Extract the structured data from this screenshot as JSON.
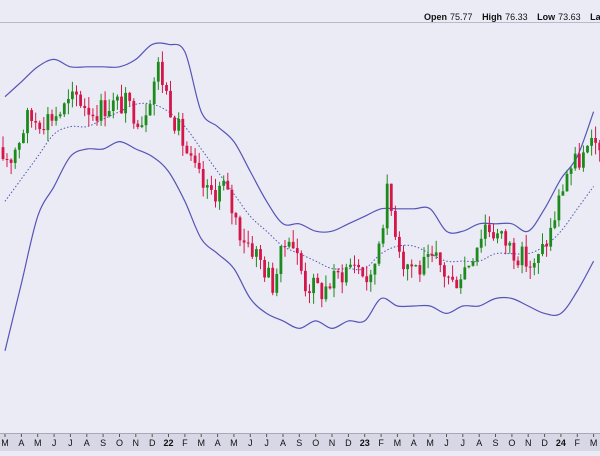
{
  "header": {
    "open_label": "Open",
    "open_value": "75.77",
    "high_label": "High",
    "high_value": "76.33",
    "low_label": "Low",
    "low_value": "73.63",
    "last_label": "Last"
  },
  "colors": {
    "background": "#ebebf5",
    "up_candle": "#1c8a1c",
    "down_candle": "#d5164a",
    "bollinger": "#5555b8",
    "axis_bg": "#d7d7e6"
  },
  "chart_data": {
    "type": "candlestick",
    "indicators": [
      "bollinger-bands-upper",
      "bollinger-bands-middle-dotted",
      "bollinger-bands-lower"
    ],
    "grid": false,
    "ylim": [
      37,
      92
    ],
    "x_tick_labels": [
      "M",
      "A",
      "M",
      "J",
      "J",
      "A",
      "S",
      "O",
      "N",
      "D",
      "22",
      "F",
      "M",
      "A",
      "M",
      "J",
      "J",
      "A",
      "S",
      "O",
      "N",
      "D",
      "23",
      "F",
      "M",
      "A",
      "M",
      "J",
      "J",
      "A",
      "S",
      "O",
      "N",
      "D",
      "24",
      "F",
      "M"
    ],
    "bold_tick_labels": [
      "22",
      "23",
      "24"
    ],
    "x": [
      "2021-03",
      "2021-04",
      "2021-05",
      "2021-06",
      "2021-07",
      "2021-08",
      "2021-09",
      "2021-10",
      "2021-11",
      "2021-12",
      "2022-01",
      "2022-02",
      "2022-03",
      "2022-04",
      "2022-05",
      "2022-06",
      "2022-07",
      "2022-08",
      "2022-09",
      "2022-10",
      "2022-11",
      "2022-12",
      "2023-01",
      "2023-02",
      "2023-03",
      "2023-04",
      "2023-05",
      "2023-06",
      "2023-07",
      "2023-08",
      "2023-09",
      "2023-10",
      "2023-11",
      "2023-12",
      "2024-01",
      "2024-02",
      "2024-03"
    ],
    "close": [
      74,
      79,
      79,
      80,
      82,
      80,
      81,
      81,
      79,
      86,
      79,
      73,
      69,
      70,
      64,
      61,
      57,
      64,
      57,
      56,
      58,
      60,
      57,
      69,
      60,
      59,
      60,
      57,
      60,
      65,
      63,
      61,
      59,
      64,
      72,
      74,
      76
    ],
    "bollinger_upper": [
      82,
      84,
      86,
      87,
      86,
      86,
      86,
      86,
      87,
      89,
      89,
      88,
      80,
      78,
      76,
      72,
      68,
      65,
      65,
      64,
      64,
      65,
      66,
      67,
      67,
      67,
      67,
      64,
      64,
      65,
      65,
      65,
      64,
      67,
      71,
      74,
      80
    ],
    "bollinger_middle": [
      68,
      71,
      74,
      77,
      78,
      78,
      79,
      80,
      81,
      81,
      80,
      78,
      75,
      72,
      69,
      66,
      64,
      62,
      61,
      60,
      59,
      59,
      59,
      61,
      62,
      62,
      61,
      60,
      60,
      60,
      61,
      61,
      61,
      62,
      64,
      67,
      70
    ],
    "bollinger_lower": [
      48,
      57,
      66,
      70,
      74,
      75,
      75,
      76,
      75,
      74,
      72,
      68,
      63,
      61,
      59,
      55,
      53,
      52,
      51,
      52,
      51,
      52,
      52,
      55,
      54,
      54,
      54,
      53,
      54,
      54,
      55,
      55,
      54,
      53,
      53,
      56,
      60
    ]
  }
}
